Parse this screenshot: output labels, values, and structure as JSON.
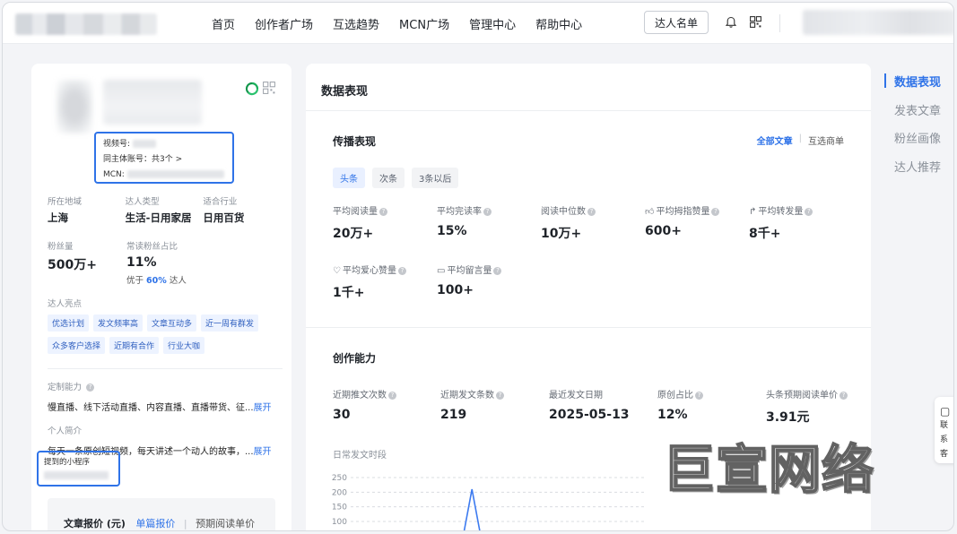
{
  "nav": {
    "items": [
      "首页",
      "创作者广场",
      "互选趋势",
      "MCN广场",
      "管理中心",
      "帮助中心"
    ],
    "kol_list_label": "达人名单"
  },
  "profile": {
    "id_box": {
      "channel_label": "视频号:",
      "same_entity_label": "同主体账号：共3个 >",
      "mcn_label": "MCN:"
    },
    "region_label": "所在地域",
    "region_value": "上海",
    "type_label": "达人类型",
    "type_value": "生活-日用家居",
    "industry_label": "适合行业",
    "industry_value": "日用百货",
    "fans_label": "粉丝量",
    "fans_value": "500万+",
    "regular_label": "常读粉丝占比",
    "regular_value": "11%",
    "better_prefix": "优于",
    "better_pct": "60%",
    "better_suffix": "达人",
    "highlights_label": "达人亮点",
    "tags": [
      "优选计划",
      "发文频率高",
      "文章互动多",
      "近一周有群发",
      "众多客户选择",
      "近期有合作",
      "行业大咖"
    ],
    "custom_label": "定制能力",
    "custom_text": "慢直播、线下活动直播、内容直播、直播带货、征...",
    "expand_label": "展开",
    "intro_label": "个人简介",
    "intro_text": "每天一条原创短视频，每天讲述一个动人的故事，...",
    "mini_program_label": "提到的小程序",
    "price_title": "文章报价 (元)",
    "price_tab_single": "单篇报价",
    "price_tab_sep": "|",
    "price_tab_cpm": "预期阅读单价"
  },
  "main": {
    "title": "数据表现",
    "spread": {
      "title": "传播表现",
      "scope_all": "全部文章",
      "scope_sep": "|",
      "scope_mutual": "互选商单",
      "pills": [
        "头条",
        "次条",
        "3条以后"
      ],
      "metrics": [
        {
          "label": "平均阅读量",
          "value": "20万+",
          "icon": ""
        },
        {
          "label": "平均完读率",
          "value": "15%",
          "icon": ""
        },
        {
          "label": "阅读中位数",
          "value": "10万+",
          "icon": ""
        },
        {
          "label": "平均拇指赞量",
          "value": "600+",
          "icon": "thumb-icon"
        },
        {
          "label": "平均转发量",
          "value": "8千+",
          "icon": "share-icon"
        },
        {
          "label": "平均爱心赞量",
          "value": "1千+",
          "icon": "heart-icon"
        },
        {
          "label": "平均留言量",
          "value": "100+",
          "icon": "comment-icon"
        }
      ]
    },
    "create": {
      "title": "创作能力",
      "metrics": [
        {
          "label": "近期推文次数",
          "value": "30"
        },
        {
          "label": "近期发文条数",
          "value": "219"
        },
        {
          "label": "最近发文日期",
          "value": "2025-05-13"
        },
        {
          "label": "原创占比",
          "value": "12%"
        },
        {
          "label": "头条预期阅读单价",
          "value": "3.91元"
        }
      ],
      "daily_label": "日常发文时段"
    }
  },
  "chart_data": {
    "type": "line",
    "title": "日常发文时段",
    "yticks": [
      250,
      200,
      150,
      100
    ],
    "ylim": [
      75,
      250
    ],
    "series": [
      {
        "values": [
          0,
          0,
          0,
          0,
          0,
          0,
          0,
          0,
          0,
          0,
          210,
          0,
          0,
          0,
          0,
          0,
          0,
          0,
          0,
          0,
          0,
          0,
          0,
          0
        ]
      }
    ],
    "grid": true
  },
  "anchor": {
    "items": [
      "数据表现",
      "发表文章",
      "粉丝画像",
      "达人推荐"
    ]
  },
  "service": {
    "line1": "联系",
    "line2": "客服"
  },
  "watermark": "巨宣网络",
  "colors": {
    "accent": "#2f73e8",
    "tag_bg": "#edf3ff"
  }
}
